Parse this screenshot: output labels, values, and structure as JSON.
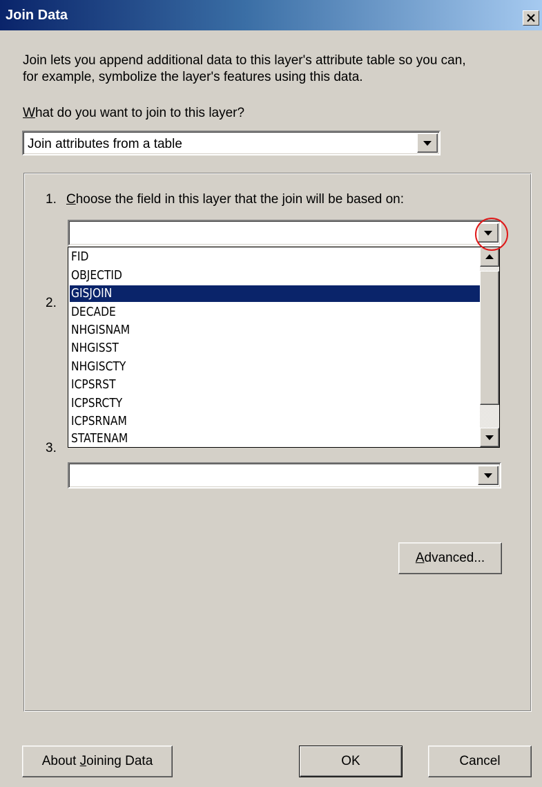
{
  "window": {
    "title": "Join Data"
  },
  "intro": {
    "line1": "Join lets you append additional data to this layer's attribute table so you can,",
    "line2": "for example, symbolize the layer's features using this data."
  },
  "join_type": {
    "label_hotkey": "W",
    "label_rest": "hat do you want to join to this layer?",
    "value": "Join attributes from a table"
  },
  "step1": {
    "number": "1.",
    "label_hotkey": "C",
    "label_rest": "hoose the field in this layer that the join will be based on:",
    "value": "",
    "options": [
      "FID",
      "OBJECTID",
      "GISJOIN",
      "DECADE",
      "NHGISNAM",
      "NHGISST",
      "NHGISCTY",
      "ICPSRST",
      "ICPSRCTY",
      "ICPSRNAM",
      "STATENAM"
    ],
    "selected": "GISJOIN"
  },
  "step2": {
    "number": "2."
  },
  "step3": {
    "number": "3.",
    "value": ""
  },
  "buttons": {
    "advanced_hotkey": "A",
    "advanced_rest": "dvanced...",
    "about_prefix": "About ",
    "about_hotkey": "J",
    "about_rest": "oining Data",
    "ok": "OK",
    "cancel": "Cancel"
  },
  "icons": {
    "close": "close-icon",
    "dropdown": "chevron-down-icon",
    "scroll_up": "scroll-up-icon",
    "scroll_down": "scroll-down-icon"
  },
  "colors": {
    "titlebar_start": "#0a246a",
    "titlebar_end": "#a6caf0",
    "face": "#d4d0c8",
    "selection": "#0a246a",
    "annotation_circle": "#e01818"
  }
}
